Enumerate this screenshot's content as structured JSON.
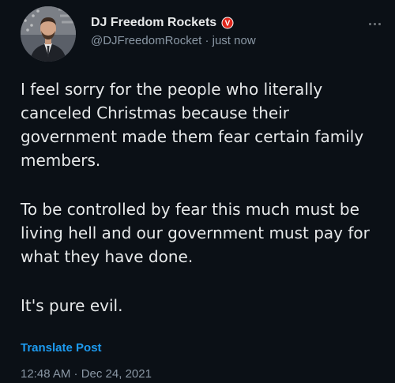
{
  "author": {
    "display_name": "DJ Freedom Rockets",
    "handle": "@DJFreedomRocket",
    "separator": "·",
    "time_ago": "just now",
    "avatar_icon": "profile-avatar",
    "badge_icon": "verified-badge-icon",
    "badge_letter": "V",
    "badge_color": "#e0261b"
  },
  "post": {
    "paragraphs": [
      "I feel sorry for the people who literally canceled Christmas because their government made them fear certain family members.",
      "To be controlled by fear this much must be living hell and our government must pay for what they have done.",
      "It's pure evil."
    ],
    "translate_label": "Translate Post",
    "timestamp": "12:48 AM · Dec 24, 2021"
  },
  "menu": {
    "icon": "more-options-icon"
  },
  "colors": {
    "background": "#0b1016",
    "text": "#e7e9ea",
    "secondary": "#8b98a5",
    "link": "#1d9bf0"
  }
}
